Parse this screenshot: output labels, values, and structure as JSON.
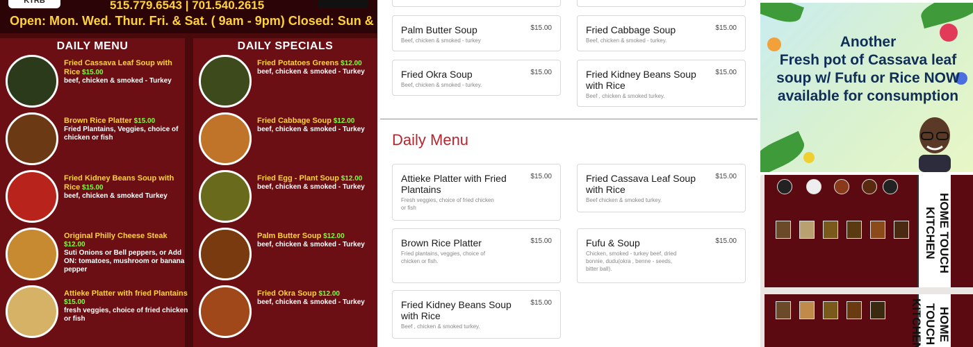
{
  "flyer": {
    "badge": "KTRB",
    "phones": "515.779.6543 | 701.540.2615",
    "hours": "Open: Mon. Wed. Thur. Fri. & Sat. ( 9am - 9pm)  Closed: Sun & Tues",
    "left_heading": "DAILY MENU",
    "right_heading": "DAILY SPECIALS",
    "left_items": [
      {
        "name": "Fried Cassava Leaf Soup with Rice",
        "price": "$15.00",
        "desc": "beef, chicken & smoked - Turkey",
        "color": "#2a3a1a"
      },
      {
        "name": "Brown Rice Platter",
        "price": "$15.00",
        "desc": "Fried Plantains, Veggies, choice of chicken or fish",
        "color": "#6b3a15"
      },
      {
        "name": "Fried Kidney Beans Soup with Rice",
        "price": "$15.00",
        "desc": "beef, chicken & smoked Turkey",
        "color": "#b8241c"
      },
      {
        "name": "Original Philly Cheese Steak",
        "price": "$12.00",
        "desc": "Suti Onions or Bell peppers, or Add ON: tomatoes, mushroom or banana pepper",
        "color": "#c88a30"
      },
      {
        "name": "Attieke Platter with fried Plantains",
        "price": "$15.00",
        "desc": "fresh veggies, choice of fried chicken or fish",
        "color": "#d6b266"
      }
    ],
    "right_items": [
      {
        "name": "Fried Potatoes Greens",
        "price": "$12.00",
        "desc": "beef, chicken & smoked - Turkey",
        "color": "#3c4a1c"
      },
      {
        "name": "Fried Cabbage Soup",
        "price": "$12.00",
        "desc": "beef, chicken & smoked - Turkey",
        "color": "#c0742a"
      },
      {
        "name": "Fried Egg - Plant Soup",
        "price": "$12.00",
        "desc": "beef, chicken & smoked - Turkey",
        "color": "#6a6a1c"
      },
      {
        "name": "Palm Butter Soup",
        "price": "$12.00",
        "desc": "beef, chicken & smoked - Turkey",
        "color": "#7a3a10"
      },
      {
        "name": "Fried Okra Soup",
        "price": "$12.00",
        "desc": "beef, chicken & smoked - Turkey",
        "color": "#a0481a"
      }
    ]
  },
  "menu": {
    "top_cards": [
      {
        "title": "Palm Butter Soup",
        "price": "$15.00",
        "desc": "Beef, chicken & smoked - turkey"
      },
      {
        "title": "Fried Cabbage Soup",
        "price": "$15.00",
        "desc": "Beef, chicken & smoked - turkey."
      },
      {
        "title": "Fried Okra Soup",
        "price": "$15.00",
        "desc": "Beef, chicken & smoked - turkey."
      },
      {
        "title": "Fried Kidney Beans Soup with Rice",
        "price": "$15.00",
        "desc": "Beef , chicken & smoked turkey."
      }
    ],
    "section_title": "Daily Menu",
    "cards": [
      {
        "title": "Attieke Platter with Fried Plantains",
        "price": "$15.00",
        "desc": "Fresh veggies, choice of fried chicken or fish"
      },
      {
        "title": "Fried Cassava Leaf Soup with Rice",
        "price": "$15.00",
        "desc": "Beef chicken & smoked turkey."
      },
      {
        "title": "Brown Rice Platter",
        "price": "$15.00",
        "desc": "Fried plantains, veggies, choice of chicken or fish."
      },
      {
        "title": "Fufu & Soup",
        "price": "$15.00",
        "desc": "Chicken, smoked - turkey beef, dried bonnie, dudu(okra , benne - seeds, bitter ball)."
      },
      {
        "title": "Fried Kidney Beans Soup with Rice",
        "price": "$15.00",
        "desc": "Beef , chicken & smoked turkey."
      }
    ]
  },
  "promo": {
    "line1": "Another",
    "line2": "Fresh pot of Cassava leaf soup w/ Fufu or Rice NOW available for consumption"
  },
  "photo": {
    "title_top": "HOME TOUCH KITCHEN",
    "title_bottom": "HOME TOUCH KITCHEN"
  }
}
